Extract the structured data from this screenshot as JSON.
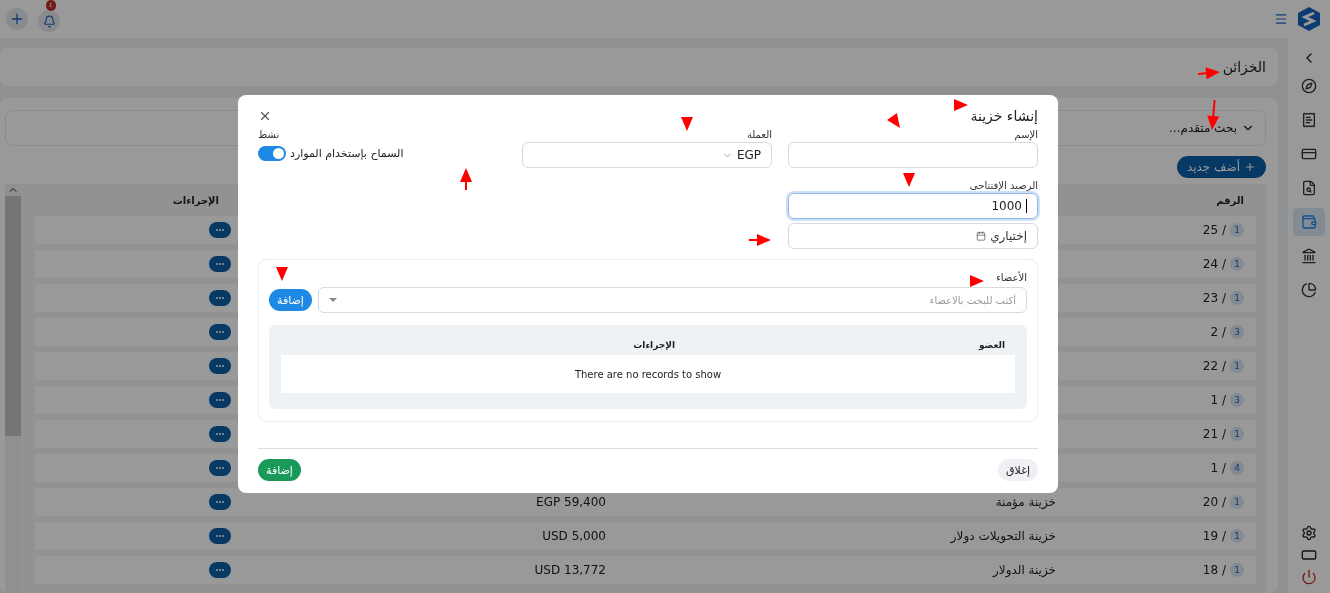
{
  "topbar": {
    "notification_count": "٤"
  },
  "page": {
    "title": "الخزائن",
    "advanced_search": "بحث متقدم...",
    "add_new": "أضف جديد",
    "table": {
      "columns": [
        "الرقم",
        "الإجراءات"
      ],
      "rows": [
        {
          "number": "25 /",
          "badge": "1"
        },
        {
          "number": "24 /",
          "badge": "1"
        },
        {
          "number": "23 /",
          "badge": "1"
        },
        {
          "number": "2 /",
          "badge": "3"
        },
        {
          "number": "22 /",
          "badge": "1"
        },
        {
          "number": "1 /",
          "badge": "3"
        },
        {
          "number": "21 /",
          "badge": "1"
        },
        {
          "number": "1 /",
          "badge": "4"
        },
        {
          "number": "20 /",
          "badge": "1",
          "name": "خزينة مؤمنة",
          "balance": "EGP 59,400"
        },
        {
          "number": "19 /",
          "badge": "1",
          "name": "خزينة التحويلات دولار",
          "balance": "USD 5,000"
        },
        {
          "number": "18 /",
          "badge": "1",
          "name": "خزينة الدولار",
          "balance": "USD 13,772"
        }
      ]
    }
  },
  "sidebar": {
    "items": [
      {
        "selected": false
      },
      {
        "selected": false
      },
      {
        "selected": false
      },
      {
        "selected": false
      },
      {
        "selected": true
      },
      {
        "selected": false
      },
      {
        "selected": false
      }
    ]
  },
  "modal": {
    "title": "إنشاء خزينة",
    "name": {
      "label": "الإسم"
    },
    "currency": {
      "label": "العملة",
      "value": "EGP"
    },
    "active": {
      "label": "نشط",
      "text": "السماح بإستخدام الموارد",
      "on": true
    },
    "opening_balance": {
      "label": "الرصيد الإفتتاحي",
      "value": "1000",
      "focused": true
    },
    "date": {
      "placeholder": "إختياري"
    },
    "members": {
      "label": "الأعضاء",
      "placeholder": "أكتب للبحث بالاعضاء",
      "add": "إضافة",
      "columns": [
        "العضو",
        "الإجراءات"
      ],
      "empty": "There are no records to show"
    },
    "buttons": {
      "close": "إغلاق",
      "submit": "إضافة"
    }
  }
}
